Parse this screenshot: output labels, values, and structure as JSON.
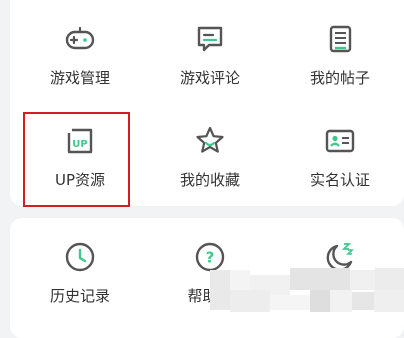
{
  "colors": {
    "icon_gray": "#555555",
    "accent_green": "#3dc98b",
    "highlight_red": "#d21f1f"
  },
  "services": {
    "row1": [
      {
        "label": "游戏管理",
        "icon": "gamepad-icon"
      },
      {
        "label": "游戏评论",
        "icon": "comment-icon"
      },
      {
        "label": "我的帖子",
        "icon": "document-icon"
      }
    ],
    "row2": [
      {
        "label": "UP资源",
        "icon": "up-badge-icon",
        "badge_text": "UP"
      },
      {
        "label": "我的收藏",
        "icon": "star-icon"
      },
      {
        "label": "实名认证",
        "icon": "id-card-icon"
      }
    ]
  },
  "tools": {
    "items": [
      {
        "label": "历史记录",
        "icon": "clock-icon"
      },
      {
        "label": "帮助中",
        "icon": "help-icon",
        "badge_text": "?"
      },
      {
        "label": "",
        "icon": "night-mode-icon"
      }
    ]
  }
}
